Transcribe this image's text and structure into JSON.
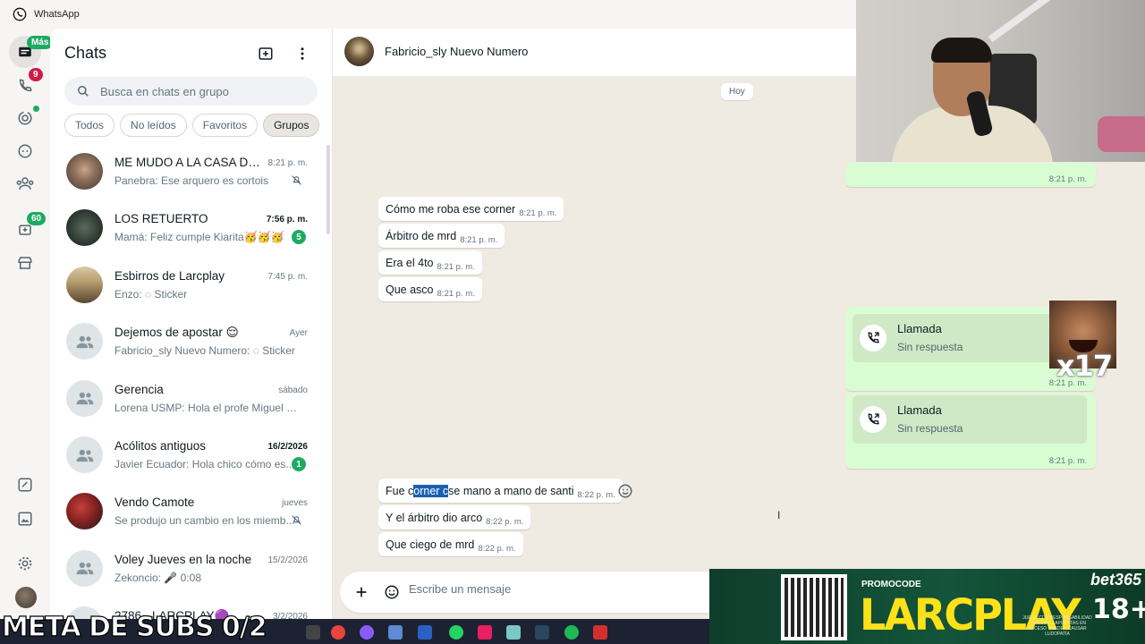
{
  "window": {
    "title": "WhatsApp"
  },
  "rail": {
    "badges": {
      "chats": "Más",
      "calls": "9",
      "archived": "60"
    }
  },
  "chat_list": {
    "title": "Chats",
    "search_placeholder": "Busca en chats en grupo",
    "filters": [
      {
        "label": "Todos",
        "active": false
      },
      {
        "label": "No leídos",
        "active": false
      },
      {
        "label": "Favoritos",
        "active": false
      },
      {
        "label": "Grupos",
        "active": true
      }
    ],
    "chats": [
      {
        "name": "ME MUDO A LA CASA DE ...",
        "time": "8:21 p. m.",
        "preview": "Panebra: Ese arquero es cortois",
        "muted": true,
        "unread": null,
        "avatar": "photo",
        "time_bold": false
      },
      {
        "name": "LOS RETUERTO",
        "time": "7:56 p. m.",
        "preview": "Mamá: Feliz cumple Kiarita🥳🥳🥳",
        "muted": false,
        "unread": "5",
        "avatar": "photo",
        "time_bold": true
      },
      {
        "name": "Esbirros de Larcplay",
        "time": "7:45 p. m.",
        "preview": "Enzo: ◌ Sticker",
        "muted": false,
        "unread": null,
        "avatar": "poster",
        "time_bold": false
      },
      {
        "name": "Dejemos de apostar 😌",
        "time": "Ayer",
        "preview": "Fabricio_sly Nuevo Numero: ◌ Sticker",
        "muted": false,
        "unread": null,
        "avatar": "group",
        "time_bold": false
      },
      {
        "name": "Gerencia",
        "time": "sábado",
        "preview": "Lorena USMP: Hola el profe Miguel me ...",
        "muted": false,
        "unread": null,
        "avatar": "group",
        "time_bold": false
      },
      {
        "name": "Acólitos antiguos",
        "time": "16/2/2026",
        "preview": "Javier Ecuador: Hola chico cómo es...",
        "muted": false,
        "unread": "1",
        "avatar": "group",
        "time_bold": true
      },
      {
        "name": "Vendo Camote",
        "time": "jueves",
        "preview": "Se produjo un cambio en los miemb...",
        "muted": true,
        "unread": null,
        "avatar": "photo-red",
        "time_bold": false
      },
      {
        "name": "Voley Jueves en la noche",
        "time": "15/2/2026",
        "preview": "Zekoncio: 🎤 0:08",
        "muted": false,
        "unread": null,
        "avatar": "group",
        "time_bold": false
      },
      {
        "name": "2786 - LARCPLAY🟣",
        "time": "3/2/2026",
        "preview": "",
        "muted": false,
        "unread": null,
        "avatar": "group",
        "time_bold": false
      }
    ]
  },
  "conversation": {
    "contact_name": "Fabricio_sly Nuevo Numero",
    "day_label": "Hoy",
    "top_out_time": "8:21 p. m.",
    "incoming_block_1": [
      {
        "text": "Cómo me roba ese corner",
        "time": "8:21 p. m."
      },
      {
        "text": "Árbitro de mrd",
        "time": "8:21 p. m."
      },
      {
        "text": "Era el 4to",
        "time": "8:21 p. m."
      },
      {
        "text": "Que asco",
        "time": "8:21 p. m."
      }
    ],
    "calls": [
      {
        "title": "Llamada",
        "status": "Sin respuesta",
        "time": "8:21 p. m."
      },
      {
        "title": "Llamada",
        "status": "Sin respuesta",
        "time": "8:21 p. m."
      }
    ],
    "incoming_block_2": [
      {
        "pre": "Fue c",
        "selected": "orner c",
        "post": "se mano a mano de santi",
        "time": "8:22 p. m."
      },
      {
        "text": "Y el árbitro dio arco",
        "time": "8:22 p. m."
      },
      {
        "text": "Que ciego de mrd",
        "time": "8:22 p. m."
      }
    ],
    "composer_placeholder": "Escribe un mensaje"
  },
  "overlays": {
    "meme_label": "x17",
    "promo": {
      "code_label": "PROMOCODE",
      "brand": "LARCPLAY",
      "sponsor": "bet365",
      "age": "18+",
      "fine_print": "JUEGA CON RESPONSABILIDAD · JUEGOS Y APUESTAS EN EXCESO PUEDEN CAUSAR LUDOPATÍA"
    },
    "subs_counter": "META DE SUBS 0/2"
  },
  "colors": {
    "accent": "#1daa61",
    "badge_red": "#cf1b46",
    "bubble_out": "#d9fdd3",
    "chat_bg": "#efeae2"
  }
}
